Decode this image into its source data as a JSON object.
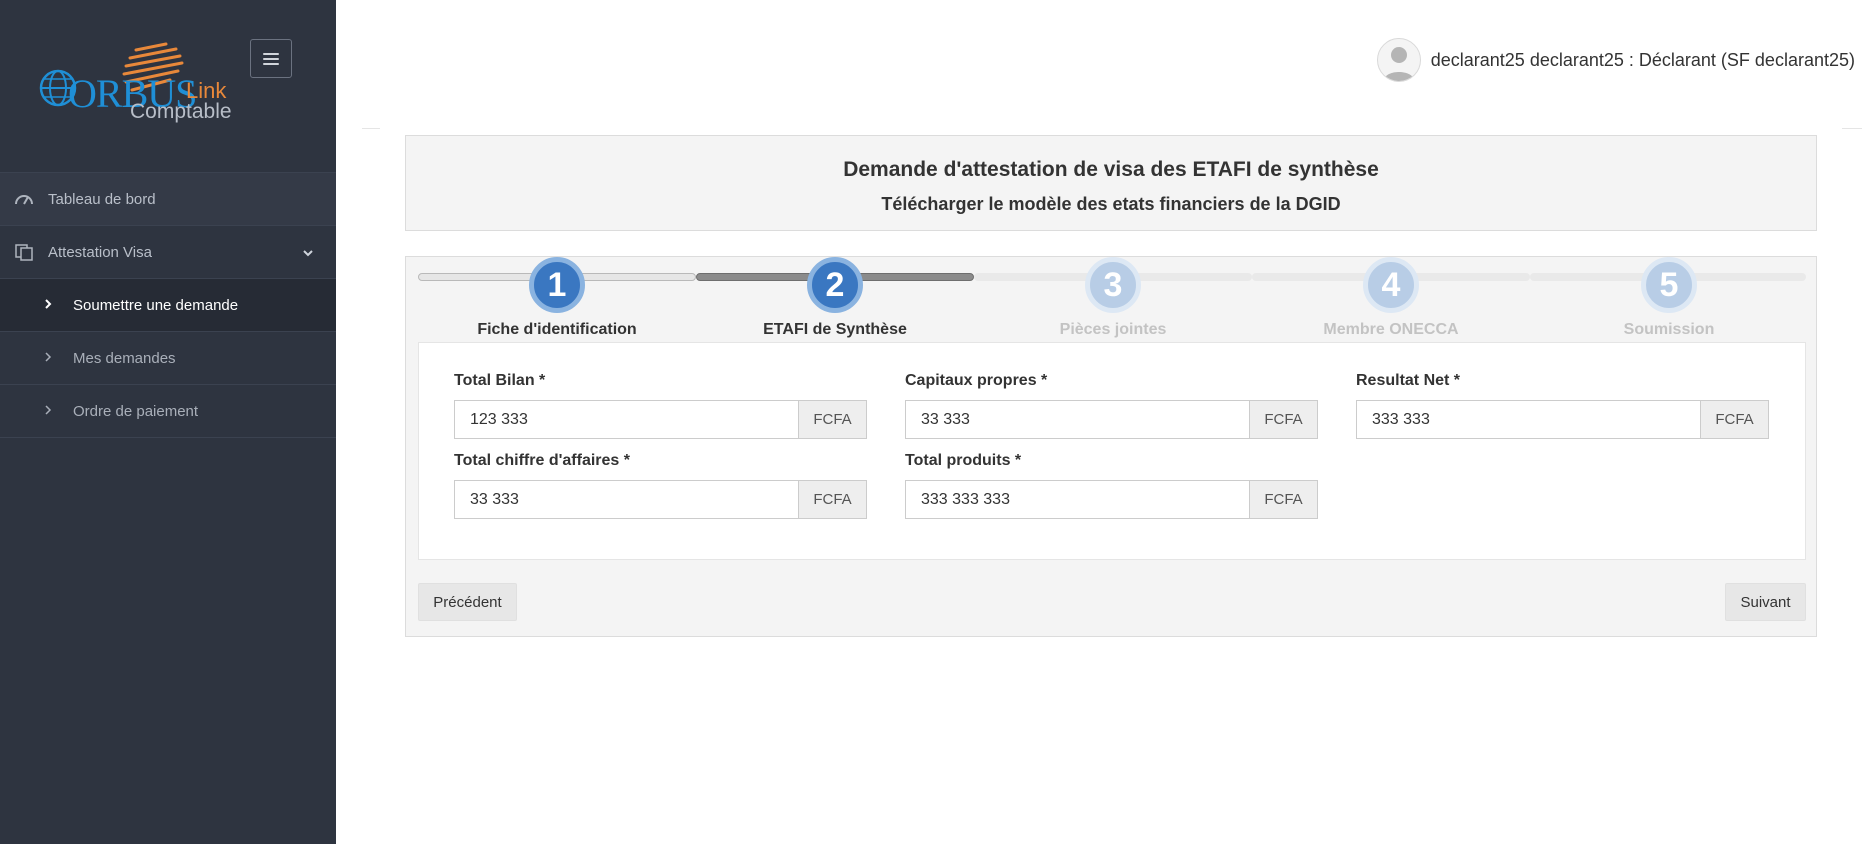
{
  "app": {
    "logo_main": "ORBUS",
    "logo_link": "Link",
    "logo_sub": "Comptable"
  },
  "sidebar": {
    "items": [
      {
        "label": "Tableau de bord",
        "icon": "dashboard-gauge-icon"
      },
      {
        "label": "Attestation Visa",
        "icon": "documents-icon",
        "expanded": true
      }
    ],
    "subitems": [
      {
        "label": "Soumettre une demande",
        "active": true
      },
      {
        "label": "Mes demandes",
        "active": false
      },
      {
        "label": "Ordre de paiement",
        "active": false
      }
    ]
  },
  "header": {
    "user_label": "declarant25 declarant25 : Déclarant (SF declarant25)"
  },
  "page": {
    "title": "Demande d'attestation de visa des ETAFI de synthèse",
    "subtitle": "Télécharger le modèle des etats financiers de la DGID"
  },
  "wizard": {
    "current_step": 2,
    "steps": [
      {
        "number": "1",
        "label": "Fiche d'identification"
      },
      {
        "number": "2",
        "label": "ETAFI de Synthèse"
      },
      {
        "number": "3",
        "label": "Pièces jointes"
      },
      {
        "number": "4",
        "label": "Membre ONECCA"
      },
      {
        "number": "5",
        "label": "Soumission"
      }
    ]
  },
  "form": {
    "currency": "FCFA",
    "fields": [
      {
        "label": "Total Bilan *",
        "value": "123 333"
      },
      {
        "label": "Capitaux propres *",
        "value": "33 333"
      },
      {
        "label": "Resultat Net *",
        "value": "333 333"
      },
      {
        "label": "Total chiffre d'affaires *",
        "value": "33 333"
      },
      {
        "label": "Total produits *",
        "value": "333 333 333"
      }
    ]
  },
  "buttons": {
    "previous": "Précédent",
    "next": "Suivant"
  },
  "colors": {
    "sidebar_bg": "#2e3440",
    "step_active": "#3a77c1",
    "step_inactive": "#b8cde6",
    "logo_blue": "#1f8fd6",
    "logo_orange": "#e8883a"
  }
}
